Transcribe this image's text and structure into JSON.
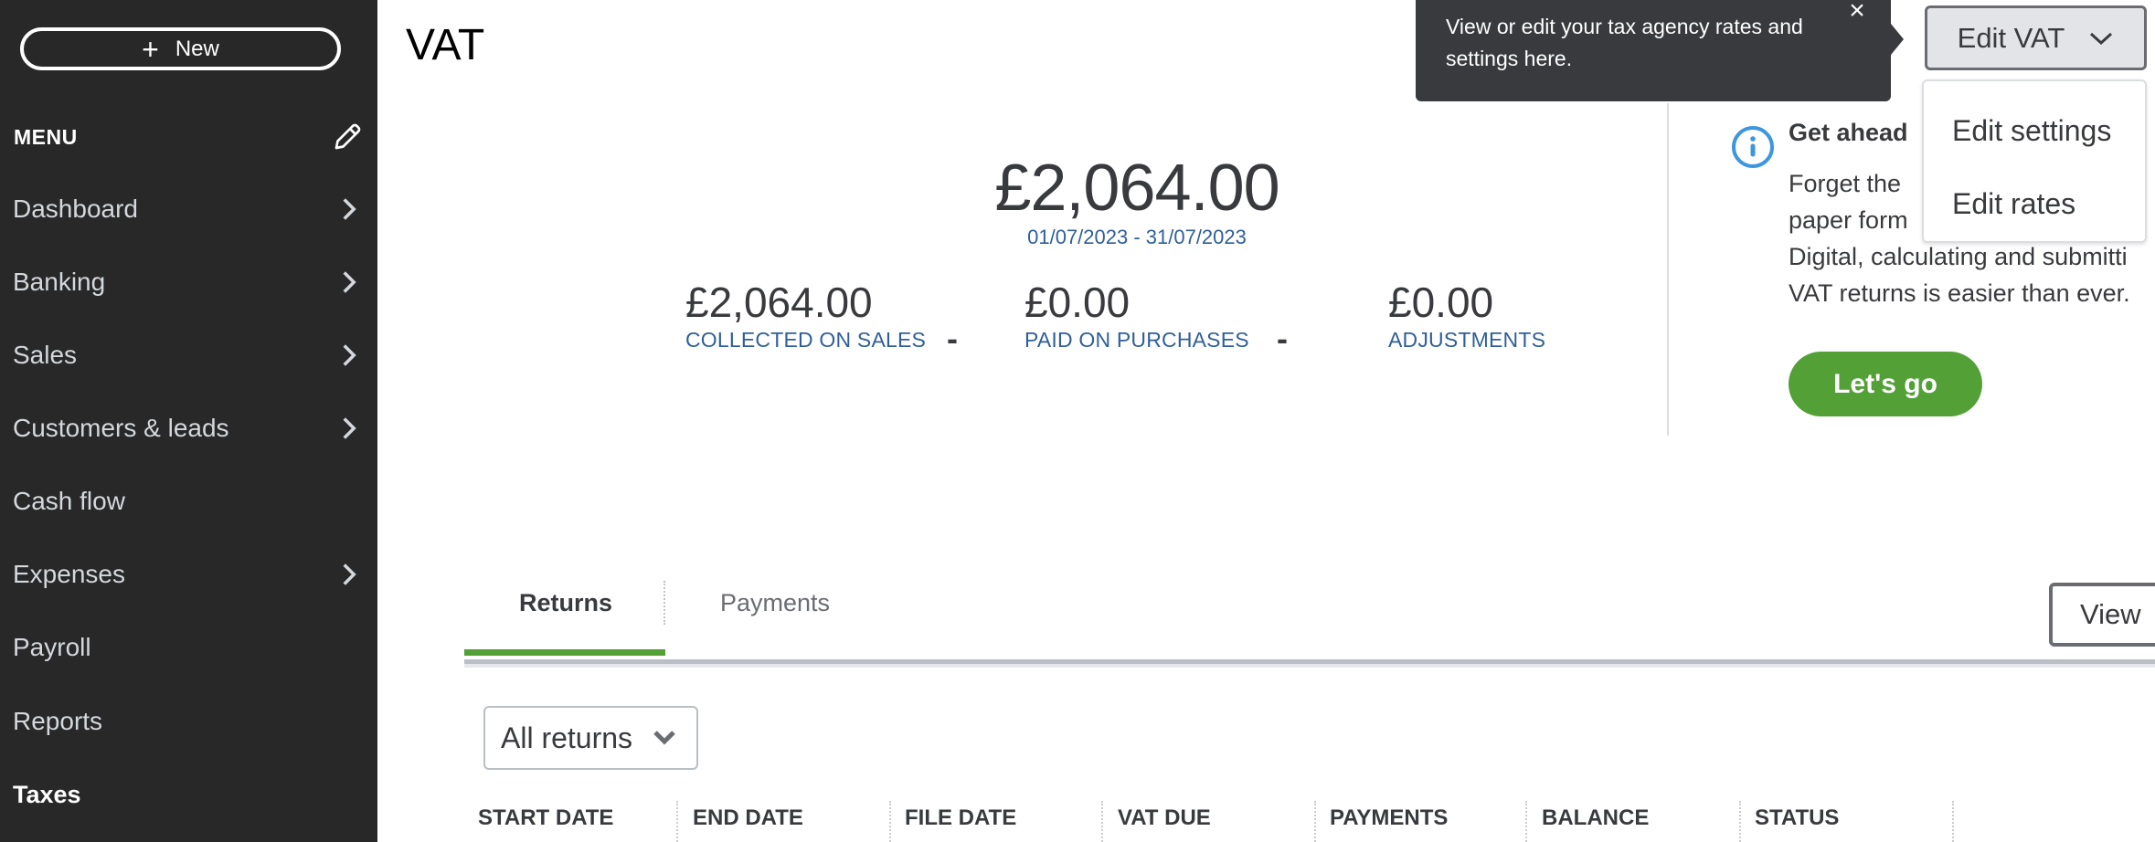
{
  "sidebar": {
    "new_button": "New",
    "menu_label": "MENU",
    "items": [
      {
        "label": "Dashboard",
        "has_chevron": true
      },
      {
        "label": "Banking",
        "has_chevron": true
      },
      {
        "label": "Sales",
        "has_chevron": true
      },
      {
        "label": "Customers & leads",
        "has_chevron": true
      },
      {
        "label": "Cash flow",
        "has_chevron": false
      },
      {
        "label": "Expenses",
        "has_chevron": true
      },
      {
        "label": "Payroll",
        "has_chevron": false
      },
      {
        "label": "Reports",
        "has_chevron": false
      },
      {
        "label": "Taxes",
        "has_chevron": false,
        "active": true
      }
    ]
  },
  "page": {
    "title": "VAT"
  },
  "summary": {
    "total": "£2,064.00",
    "period": "01/07/2023 - 31/07/2023",
    "breakdown": [
      {
        "amount": "£2,064.00",
        "label": "COLLECTED ON SALES"
      },
      {
        "amount": "£0.00",
        "label": "PAID ON PURCHASES"
      },
      {
        "amount": "£0.00",
        "label": "ADJUSTMENTS"
      }
    ],
    "operator": "-"
  },
  "tooltip": {
    "text": "View or edit your tax agency rates and settings here.",
    "close": "×"
  },
  "edit_vat": {
    "label": "Edit VAT",
    "menu": [
      "Edit settings",
      "Edit rates"
    ]
  },
  "promo": {
    "title_visible": "Get ahead",
    "lines_visible": [
      "Forget the",
      "paper form",
      "Digital, calculating and submitti",
      "VAT returns is easier than ever."
    ],
    "button": "Let's go"
  },
  "tabs": [
    {
      "label": "Returns",
      "active": true
    },
    {
      "label": "Payments",
      "active": false
    }
  ],
  "view_button": "View",
  "filter": {
    "selected": "All returns"
  },
  "table": {
    "columns": [
      "START DATE",
      "END DATE",
      "FILE DATE",
      "VAT DUE",
      "PAYMENTS",
      "BALANCE",
      "STATUS"
    ]
  },
  "colors": {
    "sidebar_bg": "#282828",
    "accent_green": "#53a037",
    "link_blue": "#2f5f99",
    "info_blue": "#3d97de",
    "tooltip_bg": "#393a3d"
  }
}
